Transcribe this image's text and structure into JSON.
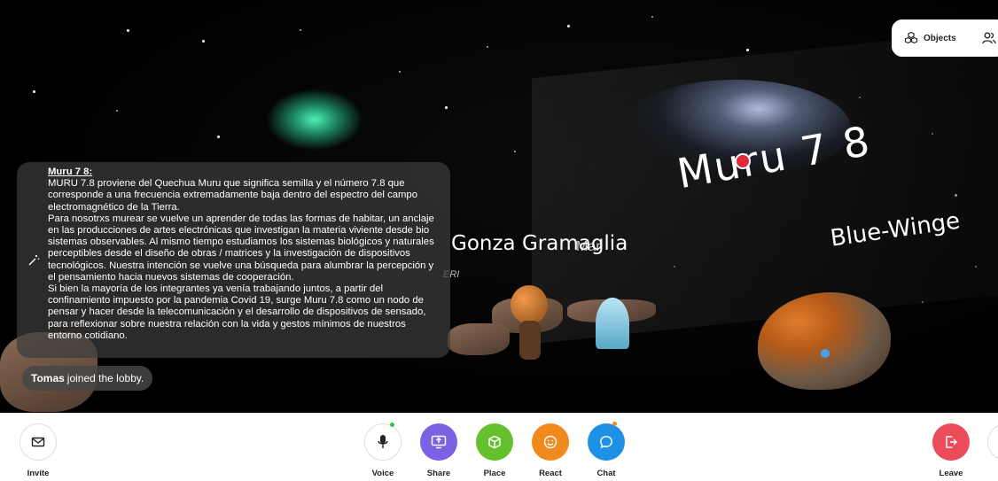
{
  "scene": {
    "sign_title": "Muru 7 8",
    "sign_subtitle": "Blue-Winge",
    "avatar_name": "Gonza Gramaglia",
    "avatar_name_overlap": "Mar",
    "avatar_tag": "ERI"
  },
  "top_bar": {
    "objects_label": "Objects",
    "objects_icon": "objects-icon",
    "people_icon": "people-icon"
  },
  "info_panel": {
    "title": "Muru 7 8:",
    "paragraphs": [
      "MURU 7.8 proviene del Quechua Muru que significa semilla y el número 7.8 que corresponde a una frecuencia extremadamente baja dentro del espectro del campo electromagnético de la Tierra.",
      "Para nosotrxs murear se vuelve un aprender de todas las formas de habitar, un anclaje en las producciones de artes electrónicas que investigan la materia viviente desde bio sistemas observables. Al mismo tiempo estudiamos los sistemas biológicos y naturales perceptibles desde el diseño de obras / matrices y la investigación de dispositivos tecnológicos. Nuestra intención se vuelve una búsqueda para alumbrar la percepción y el pensamiento hacia nuevos sistemas de cooperación.",
      "Si bien la mayoría de los integrantes ya venía trabajando juntos, a partir del confinamiento impuesto por la pandemia Covid 19, surge Muru 7.8 como un nodo de pensar y hacer desde la telecomunicación y el desarrollo de dispositivos de sensado, para reflexionar sobre nuestra relación con la vida y gestos mínimos de nuestros entorno cotidiano."
    ]
  },
  "toast": {
    "user": "Tomas",
    "message": "joined the lobby."
  },
  "toolbar": {
    "invite": "Invite",
    "voice": "Voice",
    "share": "Share",
    "place": "Place",
    "react": "React",
    "chat": "Chat",
    "leave": "Leave"
  },
  "colors": {
    "share": "#7b61e3",
    "place": "#64c02c",
    "react": "#f08a1c",
    "chat": "#1e90e6",
    "leave": "#ec4b5a"
  }
}
